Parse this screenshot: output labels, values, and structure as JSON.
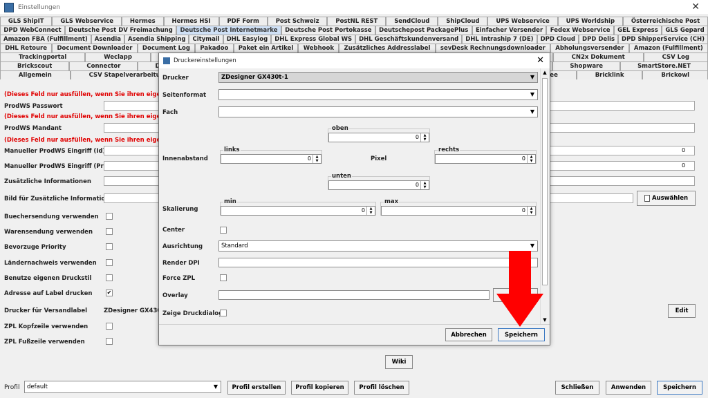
{
  "window": {
    "title": "Einstellungen"
  },
  "tabs": {
    "row1": [
      "GLS ShipIT",
      "GLS Webservice",
      "Hermes",
      "Hermes HSI",
      "PDF Form",
      "Post Schweiz",
      "PostNL REST",
      "SendCloud",
      "ShipCloud",
      "UPS Webservice",
      "UPS Worldship",
      "Österreichische Post"
    ],
    "row2": [
      "DPD WebConnect",
      "Deutsche Post DV Freimachung",
      "Deutsche Post Internetmarke",
      "Deutsche Post Portokasse",
      "Deutschepost PackagePlus",
      "Einfacher Versender",
      "Fedex Webservice",
      "GEL Express",
      "GLS Gepard"
    ],
    "row3": [
      "Amazon FBA (Fulfillment)",
      "Asendia",
      "Asendia Shipping",
      "Citymail",
      "DHL Easylog",
      "DHL Express Global WS",
      "DHL Geschäftskundenversand",
      "DHL Intraship 7 (DE)",
      "DPD Cloud",
      "DPD Delis",
      "DPD ShipperService (CH)"
    ],
    "row4": [
      "DHL Retoure",
      "Document Downloader",
      "Document Log",
      "Pakadoo",
      "Paket ein Artikel",
      "Webhook",
      "Zusätzliches Addresslabel",
      "sevDesk Rechnungsdownloader",
      "Abholungsversender",
      "Amazon (Fulfillment)"
    ],
    "row5": [
      "Trackingportal",
      "Weclapp",
      "WooCommerce",
      "",
      "",
      "",
      "",
      "",
      "",
      "ng als Rechnung",
      "CN2x Dokument",
      "CSV Log"
    ],
    "row6": [
      "Brickscout",
      "Connector",
      "Database Shop",
      "Disc",
      "",
      "",
      "",
      "",
      "",
      "Real",
      "Shopify",
      "Shopware",
      "SmartStore.NET"
    ],
    "row7": [
      "Allgemein",
      "CSV Stapelverarbeitung",
      "Proxy",
      "S",
      "",
      "",
      "",
      "",
      "BigCommerce",
      "Billbee",
      "Bricklink",
      "Brickowl"
    ],
    "active": "Deutsche Post Internetmarke"
  },
  "form": {
    "warning": "(Dieses Feld nur ausfüllen, wenn Sie ihren eigenen Pro",
    "prodws_passwort": "ProdWS Passwort",
    "prodws_mandant": "ProdWS Mandant",
    "manual_id": "Manueller ProdWS Eingriff (Id) *",
    "manual_preis": "Manueller ProdWS Eingriff (Preis)",
    "zusaetzliche_info": "Zusätzliche Informationen",
    "bild_info": "Bild für Zusätzliche Informationen",
    "buechersendung": "Buechersendung verwenden",
    "warensendung": "Warensendung verwenden",
    "bevorzuge_priority": "Bevorzuge Priority",
    "laendernachweis": "Ländernachweis verwenden",
    "eigener_druckstil": "Benutze eigenen Druckstil",
    "adresse_label": "Adresse auf Label drucken",
    "drucker_versandlabel": "Drucker für Versandlabel",
    "drucker_value": "ZDesigner GX430t-",
    "zpl_kopf": "ZPL Kopfzeile verwenden",
    "zpl_fuss": "ZPL Fußzeile verwenden",
    "spin_id": "0",
    "spin_preis": "0",
    "checkmark": "✔",
    "auswaehlen": "Auswählen",
    "edit": "Edit",
    "wiki": "Wiki"
  },
  "dialog": {
    "title": "Druckereinstellungen",
    "drucker_label": "Drucker",
    "drucker_value": "ZDesigner GX430t-1",
    "seitenformat_label": "Seitenformat",
    "fach_label": "Fach",
    "innenabstand_label": "Innenabstand",
    "oben": "oben",
    "links": "links",
    "rechts": "rechts",
    "unten": "unten",
    "pixel": "Pixel",
    "skalierung_label": "Skalierung",
    "min": "min",
    "max": "max",
    "center_label": "Center",
    "ausrichtung_label": "Ausrichtung",
    "ausrichtung_value": "Standard",
    "render_dpi_label": "Render DPI",
    "force_zpl_label": "Force ZPL",
    "overlay_label": "Overlay",
    "zeige_druckdialog_label": "Zeige Druckdialog",
    "zero": "0",
    "abbrechen": "Abbrechen",
    "speichern": "Speichern"
  },
  "bottom": {
    "profil_label": "Profil",
    "profil_value": "default",
    "profil_erstellen": "Profil erstellen",
    "profil_kopieren": "Profil kopieren",
    "profil_loeschen": "Profil löschen",
    "schliessen": "Schließen",
    "anwenden": "Anwenden",
    "speichern": "Speichern"
  },
  "colors": {
    "warning": "#e00000",
    "active_tab": "#cfe0f5",
    "arrow": "#ff0000"
  }
}
